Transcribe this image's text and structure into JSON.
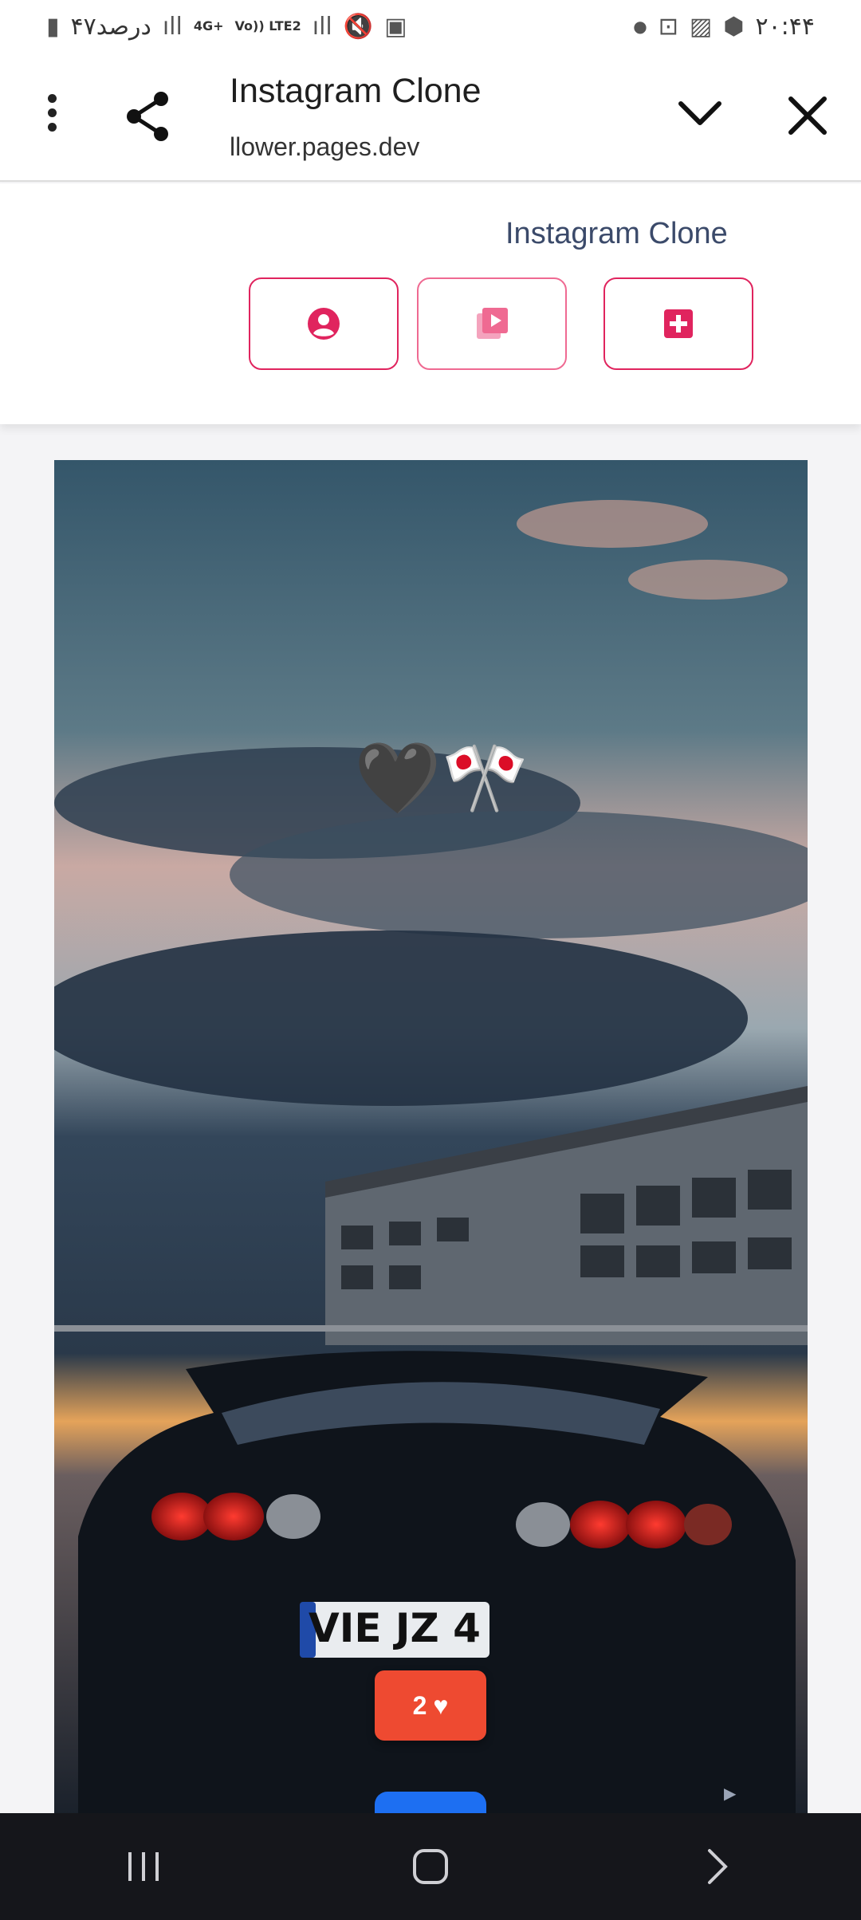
{
  "status_bar": {
    "time": "۲۰:۴۴",
    "battery_text": "۴۷درصد",
    "network_4g": "4G+",
    "network_volte": "Vo)) LTE2"
  },
  "browser": {
    "title": "Instagram Clone",
    "url": "llower.pages.dev"
  },
  "app": {
    "title": "Instagram Clone",
    "nav_buttons": [
      {
        "icon": "profile-icon"
      },
      {
        "icon": "reels-icon"
      },
      {
        "icon": "add-post-icon"
      }
    ],
    "accent_color": "#e0245e"
  },
  "post": {
    "caption": "🖤🎌",
    "like_count": "2",
    "like_icon": "♥",
    "like_badge_color": "#ee4a31",
    "license_plate": "VIE JZ 4"
  },
  "system_nav": {
    "buttons": [
      "recents-icon",
      "home-icon",
      "back-icon"
    ]
  }
}
